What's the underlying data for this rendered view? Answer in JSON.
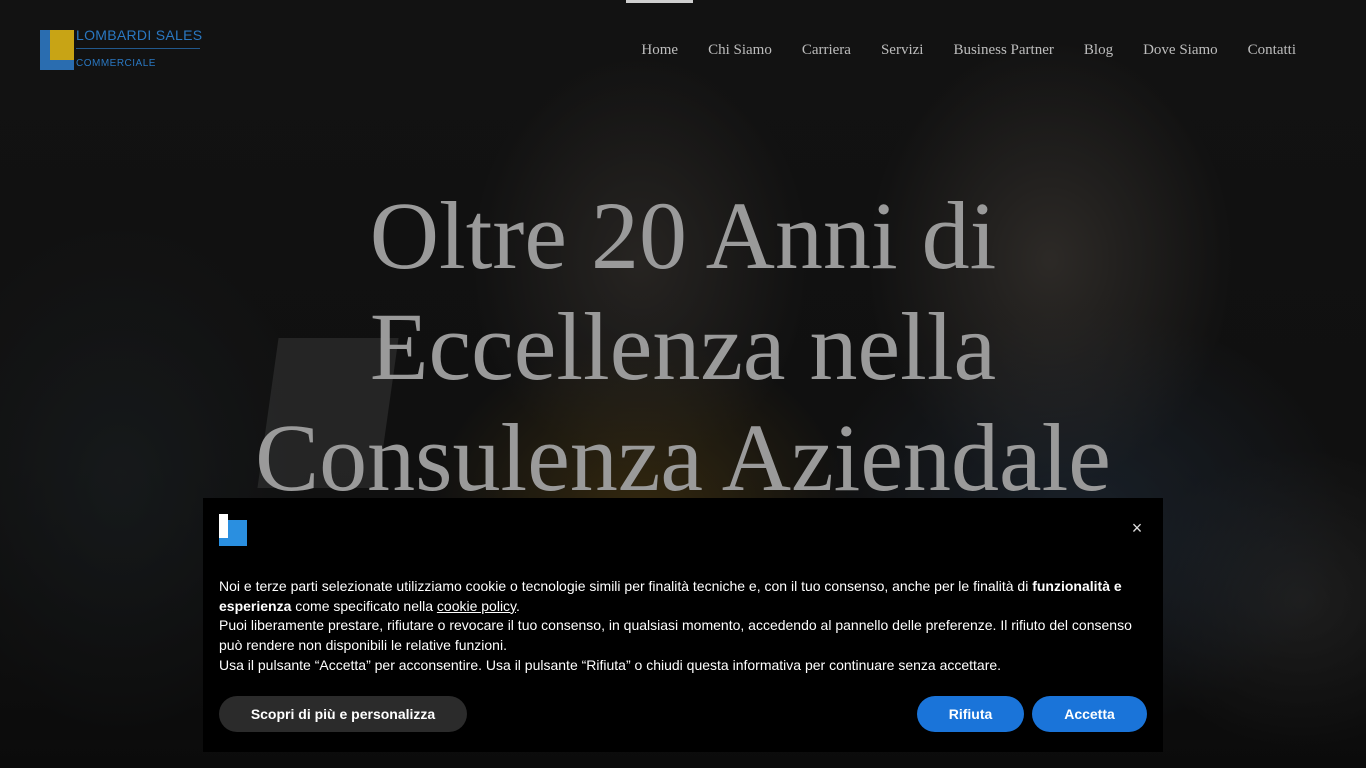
{
  "logo": {
    "name_top": "LOMBARDI SALES",
    "name_bottom": "COMMERCIALE",
    "colors": {
      "blue": "#2a6db0",
      "yellow": "#c8a415"
    }
  },
  "nav": {
    "items": [
      {
        "label": "Home",
        "active": true
      },
      {
        "label": "Chi Siamo"
      },
      {
        "label": "Carriera"
      },
      {
        "label": "Servizi"
      },
      {
        "label": "Business Partner"
      },
      {
        "label": "Blog"
      },
      {
        "label": "Dove Siamo"
      },
      {
        "label": "Contatti"
      }
    ]
  },
  "hero": {
    "lines": [
      "Oltre 20 Anni di",
      "Eccellenza nella",
      "Consulenza Aziendale"
    ]
  },
  "cookie_banner": {
    "close_icon": "×",
    "p1_a": "Noi e terze parti selezionate utilizziamo cookie o tecnologie simili per finalità tecniche e, con il tuo consenso, anche per le finalità di ",
    "p1_bold": "funzionalità e esperienza",
    "p1_b": " come specificato nella ",
    "p1_link": "cookie policy",
    "p1_c": ".",
    "p2": "Puoi liberamente prestare, rifiutare o revocare il tuo consenso, in qualsiasi momento, accedendo al pannello delle preferenze. Il rifiuto del consenso può rendere non disponibili le relative funzioni.",
    "p3": "Usa il pulsante “Accetta” per acconsentire. Usa il pulsante “Rifiuta” o chiudi questa informativa per continuare senza accettare.",
    "buttons": {
      "more": "Scopri di più e personalizza",
      "reject": "Rifiuta",
      "accept": "Accetta"
    },
    "accent_color": "#1a74d9"
  }
}
